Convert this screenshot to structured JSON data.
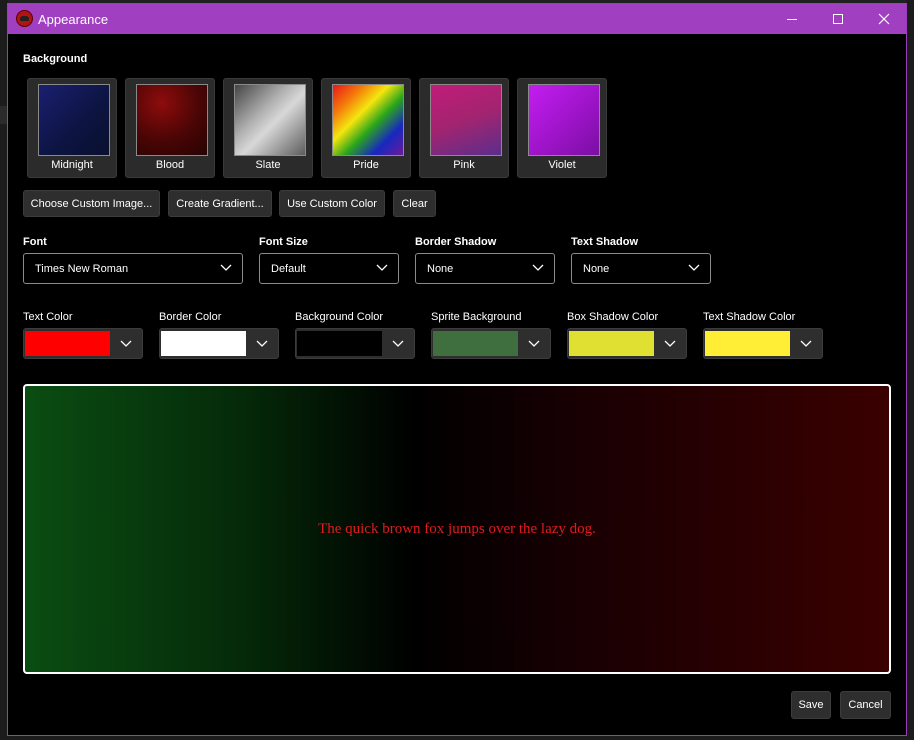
{
  "window": {
    "title": "Appearance"
  },
  "background": {
    "title": "Background",
    "presets": [
      {
        "label": "Midnight",
        "icon": "midnight-thumbnail"
      },
      {
        "label": "Blood",
        "icon": "blood-thumbnail"
      },
      {
        "label": "Slate",
        "icon": "slate-thumbnail"
      },
      {
        "label": "Pride",
        "icon": "pride-thumbnail"
      },
      {
        "label": "Pink",
        "icon": "pink-thumbnail"
      },
      {
        "label": "Violet",
        "icon": "violet-thumbnail"
      }
    ],
    "buttons": {
      "choose_image": "Choose Custom Image...",
      "create_gradient": "Create Gradient...",
      "custom_color": "Use Custom Color",
      "clear": "Clear"
    }
  },
  "font": {
    "label": "Font",
    "value": "Times New Roman"
  },
  "font_size": {
    "label": "Font Size",
    "value": "Default"
  },
  "border_shadow": {
    "label": "Border Shadow",
    "value": "None"
  },
  "text_shadow": {
    "label": "Text Shadow",
    "value": "None"
  },
  "colors": {
    "text": {
      "label": "Text Color",
      "value": "#ff0000"
    },
    "border": {
      "label": "Border Color",
      "value": "#ffffff"
    },
    "background": {
      "label": "Background Color",
      "value": "#000000"
    },
    "sprite_background": {
      "label": "Sprite Background",
      "value": "#3f6e3f"
    },
    "box_shadow": {
      "label": "Box Shadow Color",
      "value": "#e0e032"
    },
    "text_shadow": {
      "label": "Text Shadow Color",
      "value": "#ffee35"
    }
  },
  "preview": {
    "text": "The quick brown fox jumps over the lazy dog."
  },
  "footer": {
    "save": "Save",
    "cancel": "Cancel"
  }
}
